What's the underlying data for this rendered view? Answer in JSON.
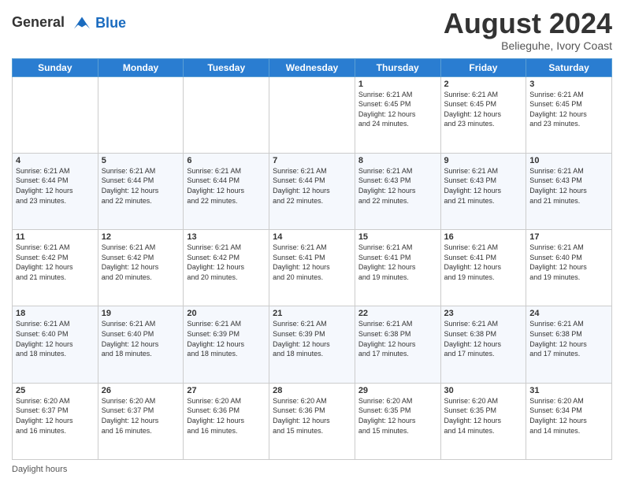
{
  "header": {
    "logo_line1": "General",
    "logo_line2": "Blue",
    "month_title": "August 2024",
    "location": "Belieguhe, Ivory Coast"
  },
  "footer": {
    "daylight_label": "Daylight hours"
  },
  "days_of_week": [
    "Sunday",
    "Monday",
    "Tuesday",
    "Wednesday",
    "Thursday",
    "Friday",
    "Saturday"
  ],
  "weeks": [
    [
      {
        "day": "",
        "info": ""
      },
      {
        "day": "",
        "info": ""
      },
      {
        "day": "",
        "info": ""
      },
      {
        "day": "",
        "info": ""
      },
      {
        "day": "1",
        "info": "Sunrise: 6:21 AM\nSunset: 6:45 PM\nDaylight: 12 hours\nand 24 minutes."
      },
      {
        "day": "2",
        "info": "Sunrise: 6:21 AM\nSunset: 6:45 PM\nDaylight: 12 hours\nand 23 minutes."
      },
      {
        "day": "3",
        "info": "Sunrise: 6:21 AM\nSunset: 6:45 PM\nDaylight: 12 hours\nand 23 minutes."
      }
    ],
    [
      {
        "day": "4",
        "info": "Sunrise: 6:21 AM\nSunset: 6:44 PM\nDaylight: 12 hours\nand 23 minutes."
      },
      {
        "day": "5",
        "info": "Sunrise: 6:21 AM\nSunset: 6:44 PM\nDaylight: 12 hours\nand 22 minutes."
      },
      {
        "day": "6",
        "info": "Sunrise: 6:21 AM\nSunset: 6:44 PM\nDaylight: 12 hours\nand 22 minutes."
      },
      {
        "day": "7",
        "info": "Sunrise: 6:21 AM\nSunset: 6:44 PM\nDaylight: 12 hours\nand 22 minutes."
      },
      {
        "day": "8",
        "info": "Sunrise: 6:21 AM\nSunset: 6:43 PM\nDaylight: 12 hours\nand 22 minutes."
      },
      {
        "day": "9",
        "info": "Sunrise: 6:21 AM\nSunset: 6:43 PM\nDaylight: 12 hours\nand 21 minutes."
      },
      {
        "day": "10",
        "info": "Sunrise: 6:21 AM\nSunset: 6:43 PM\nDaylight: 12 hours\nand 21 minutes."
      }
    ],
    [
      {
        "day": "11",
        "info": "Sunrise: 6:21 AM\nSunset: 6:42 PM\nDaylight: 12 hours\nand 21 minutes."
      },
      {
        "day": "12",
        "info": "Sunrise: 6:21 AM\nSunset: 6:42 PM\nDaylight: 12 hours\nand 20 minutes."
      },
      {
        "day": "13",
        "info": "Sunrise: 6:21 AM\nSunset: 6:42 PM\nDaylight: 12 hours\nand 20 minutes."
      },
      {
        "day": "14",
        "info": "Sunrise: 6:21 AM\nSunset: 6:41 PM\nDaylight: 12 hours\nand 20 minutes."
      },
      {
        "day": "15",
        "info": "Sunrise: 6:21 AM\nSunset: 6:41 PM\nDaylight: 12 hours\nand 19 minutes."
      },
      {
        "day": "16",
        "info": "Sunrise: 6:21 AM\nSunset: 6:41 PM\nDaylight: 12 hours\nand 19 minutes."
      },
      {
        "day": "17",
        "info": "Sunrise: 6:21 AM\nSunset: 6:40 PM\nDaylight: 12 hours\nand 19 minutes."
      }
    ],
    [
      {
        "day": "18",
        "info": "Sunrise: 6:21 AM\nSunset: 6:40 PM\nDaylight: 12 hours\nand 18 minutes."
      },
      {
        "day": "19",
        "info": "Sunrise: 6:21 AM\nSunset: 6:40 PM\nDaylight: 12 hours\nand 18 minutes."
      },
      {
        "day": "20",
        "info": "Sunrise: 6:21 AM\nSunset: 6:39 PM\nDaylight: 12 hours\nand 18 minutes."
      },
      {
        "day": "21",
        "info": "Sunrise: 6:21 AM\nSunset: 6:39 PM\nDaylight: 12 hours\nand 18 minutes."
      },
      {
        "day": "22",
        "info": "Sunrise: 6:21 AM\nSunset: 6:38 PM\nDaylight: 12 hours\nand 17 minutes."
      },
      {
        "day": "23",
        "info": "Sunrise: 6:21 AM\nSunset: 6:38 PM\nDaylight: 12 hours\nand 17 minutes."
      },
      {
        "day": "24",
        "info": "Sunrise: 6:21 AM\nSunset: 6:38 PM\nDaylight: 12 hours\nand 17 minutes."
      }
    ],
    [
      {
        "day": "25",
        "info": "Sunrise: 6:20 AM\nSunset: 6:37 PM\nDaylight: 12 hours\nand 16 minutes."
      },
      {
        "day": "26",
        "info": "Sunrise: 6:20 AM\nSunset: 6:37 PM\nDaylight: 12 hours\nand 16 minutes."
      },
      {
        "day": "27",
        "info": "Sunrise: 6:20 AM\nSunset: 6:36 PM\nDaylight: 12 hours\nand 16 minutes."
      },
      {
        "day": "28",
        "info": "Sunrise: 6:20 AM\nSunset: 6:36 PM\nDaylight: 12 hours\nand 15 minutes."
      },
      {
        "day": "29",
        "info": "Sunrise: 6:20 AM\nSunset: 6:35 PM\nDaylight: 12 hours\nand 15 minutes."
      },
      {
        "day": "30",
        "info": "Sunrise: 6:20 AM\nSunset: 6:35 PM\nDaylight: 12 hours\nand 14 minutes."
      },
      {
        "day": "31",
        "info": "Sunrise: 6:20 AM\nSunset: 6:34 PM\nDaylight: 12 hours\nand 14 minutes."
      }
    ]
  ]
}
